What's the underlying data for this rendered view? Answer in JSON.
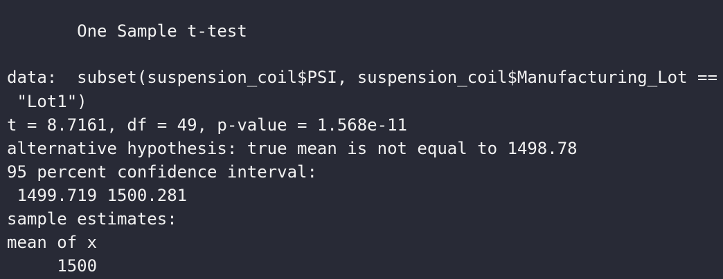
{
  "console": {
    "lines": [
      "       One Sample t-test",
      "data:  subset(suspension_coil$PSI, suspension_coil$Manufacturing_Lot ==",
      " \"Lot1\")",
      "t = 8.7161, df = 49, p-value = 1.568e-11",
      "alternative hypothesis: true mean is not equal to 1498.78",
      "95 percent confidence interval:",
      " 1499.719 1500.281",
      "sample estimates:",
      "mean of x",
      "     1500"
    ]
  }
}
